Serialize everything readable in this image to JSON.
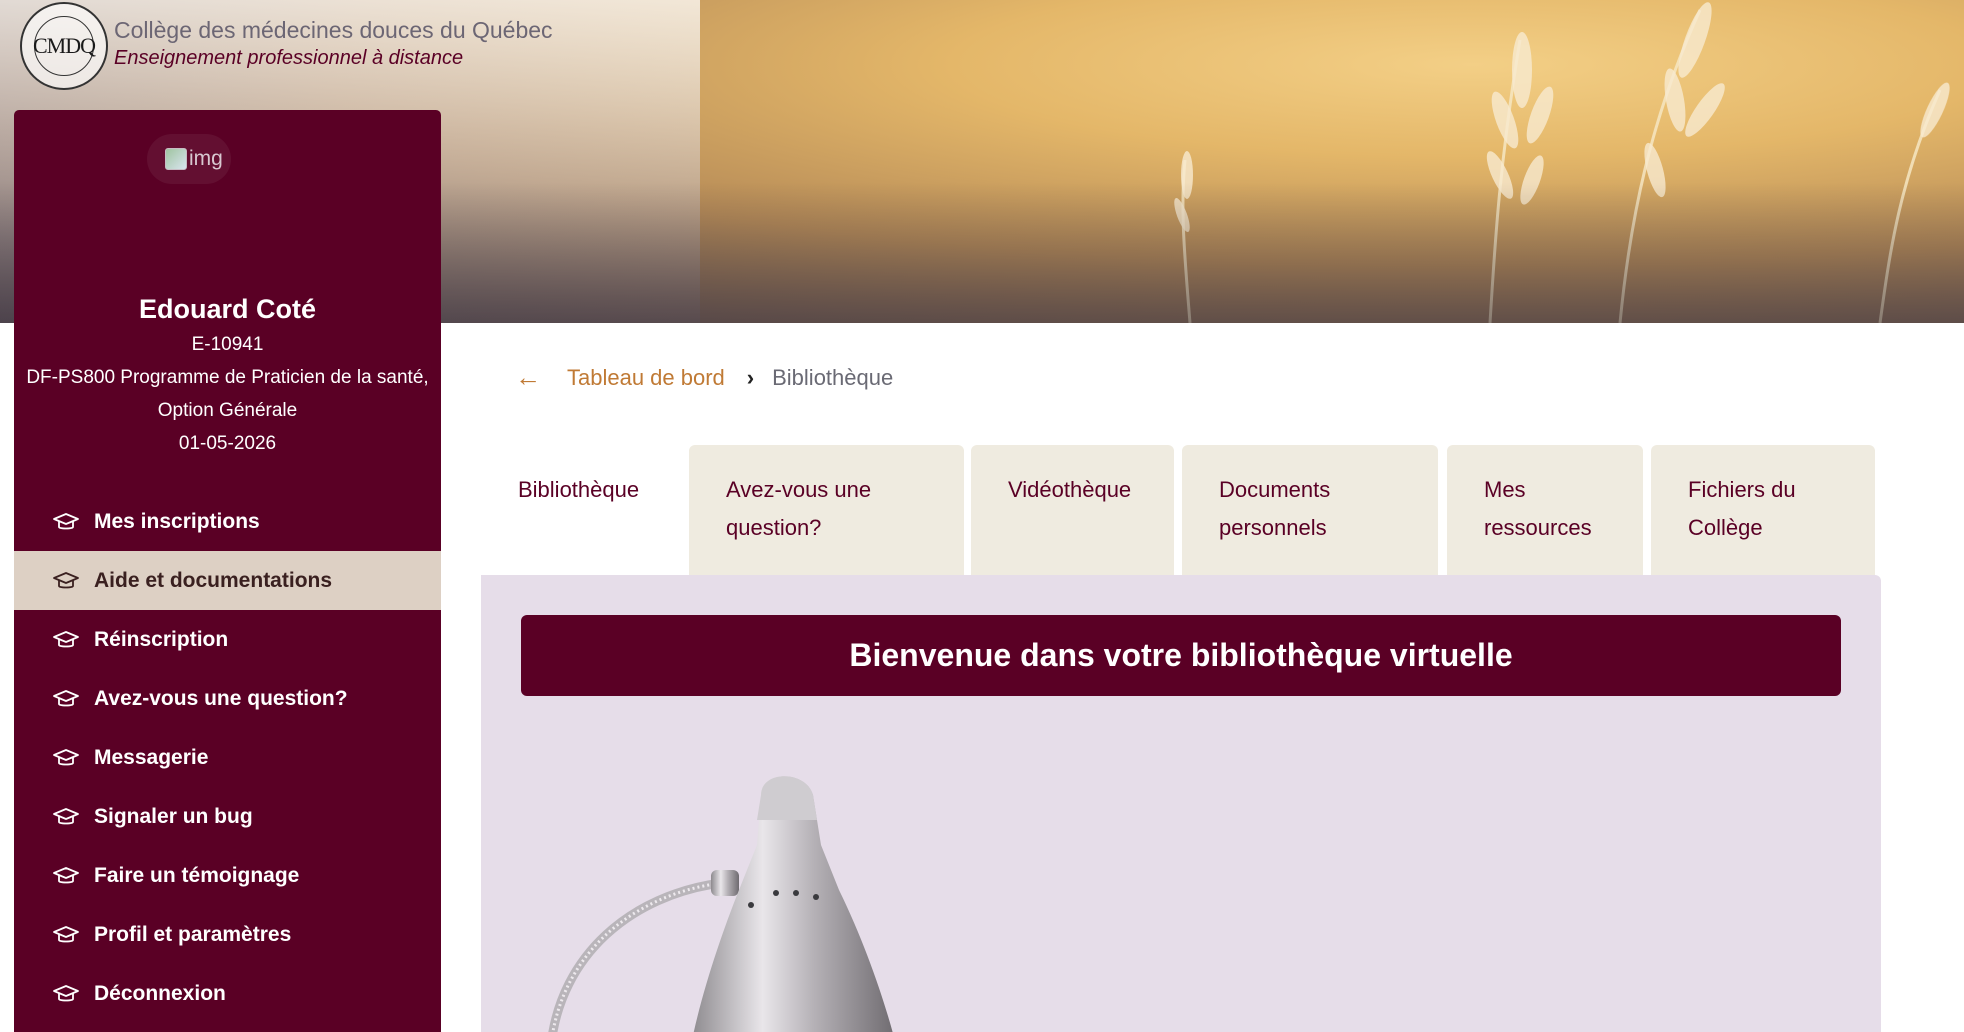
{
  "brand": {
    "logo_text": "CMDQ",
    "name": "Collège des médecines douces du Québec",
    "tagline": "Enseignement professionnel à distance"
  },
  "sidebar": {
    "avatar_alt": "img",
    "user_name": "Edouard Coté",
    "student_id": "E-10941",
    "program_line1": "DF-PS800 Programme de Praticien de la santé,",
    "program_line2": "Option Générale",
    "date": "01-05-2026",
    "items": [
      {
        "label": "Mes inscriptions",
        "icon": "graduation-cap-icon"
      },
      {
        "label": "Aide et documentations",
        "icon": "graduation-cap-icon",
        "active": true
      },
      {
        "label": "Réinscription",
        "icon": "graduation-cap-icon"
      },
      {
        "label": "Avez-vous une question?",
        "icon": "graduation-cap-icon"
      },
      {
        "label": "Messagerie",
        "icon": "graduation-cap-icon"
      },
      {
        "label": "Signaler un bug",
        "icon": "graduation-cap-icon"
      },
      {
        "label": "Faire un témoignage",
        "icon": "graduation-cap-icon"
      },
      {
        "label": "Profil et paramètres",
        "icon": "graduation-cap-icon"
      },
      {
        "label": "Déconnexion",
        "icon": "graduation-cap-icon"
      }
    ]
  },
  "breadcrumb": {
    "back_icon": "arrow-left-icon",
    "home": "Tableau de bord",
    "separator_icon": "chevron-right-icon",
    "current": "Bibliothèque"
  },
  "tabs": [
    {
      "line1": "Bibliothèque",
      "line2": "",
      "active": true
    },
    {
      "line1": "Avez-vous une",
      "line2": "question?"
    },
    {
      "line1": "Vidéothèque",
      "line2": ""
    },
    {
      "line1": "Documents",
      "line2": "personnels"
    },
    {
      "line1": "Mes",
      "line2": "ressources"
    },
    {
      "line1": "Fichiers du",
      "line2": "Collège"
    }
  ],
  "main": {
    "welcome_title": "Bienvenue dans votre bibliothèque virtuelle"
  },
  "colors": {
    "primary": "#5a0025",
    "accent": "#c07a35",
    "active_item_bg": "#ddd0c4",
    "tab_bg": "#efebe0",
    "panel_bg": "#e6dde9"
  }
}
